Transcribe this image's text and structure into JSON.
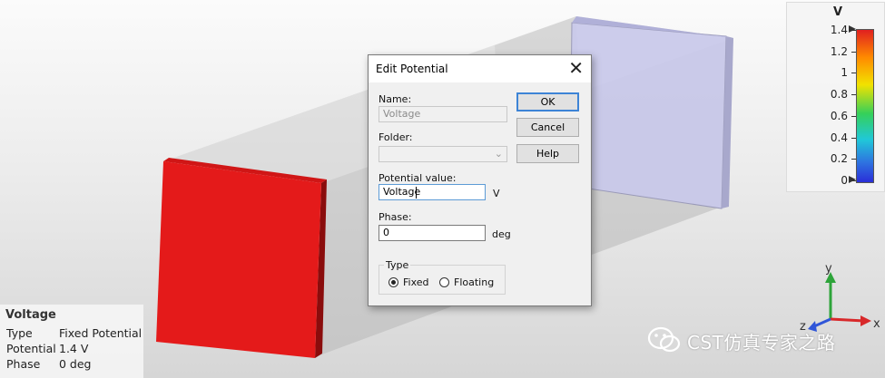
{
  "legend": {
    "unit": "V",
    "ticks": [
      "1.4",
      "1.2",
      "1",
      "0.8",
      "0.6",
      "0.4",
      "0.2",
      "0"
    ]
  },
  "info_panel": {
    "title": "Voltage",
    "rows": [
      {
        "key": "Type",
        "value": "Fixed Potential"
      },
      {
        "key": "Potential",
        "value": "1.4 V"
      },
      {
        "key": "Phase",
        "value": "0 deg"
      }
    ]
  },
  "dialog": {
    "title": "Edit Potential",
    "name_label": "Name:",
    "name_value": "Voltage",
    "folder_label": "Folder:",
    "folder_value": "",
    "potential_label": "Potential value:",
    "potential_value": "Voltage",
    "potential_unit": "V",
    "phase_label": "Phase:",
    "phase_value": "0",
    "phase_unit": "deg",
    "type_group_label": "Type",
    "type_options": [
      "Fixed",
      "Floating"
    ],
    "type_selected": "Fixed",
    "buttons": {
      "ok": "OK",
      "cancel": "Cancel",
      "help": "Help"
    }
  },
  "axes": {
    "x": "x",
    "y": "y",
    "z": "z"
  },
  "watermark": {
    "text": "CST仿真专家之路"
  },
  "colors": {
    "left_plate": "#e41a1a",
    "right_plate": "#c8c8ec",
    "axis_x": "#d8282a",
    "axis_y": "#2ea43a",
    "axis_z": "#2f55d8"
  }
}
